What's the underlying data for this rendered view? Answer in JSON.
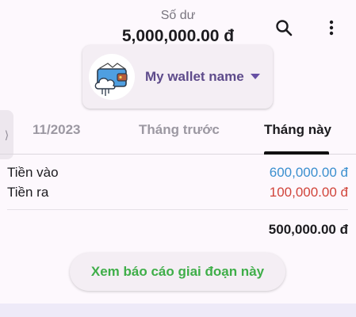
{
  "header": {
    "balance_label": "Số dư",
    "balance_value": "5,000,000.00 đ"
  },
  "icons": {
    "search": "search-icon",
    "more": "more-vert-icon",
    "wallet": "wallet-icon",
    "caret": "caret-down-icon",
    "side_handle": "chevron-right-icon"
  },
  "wallet": {
    "name": "My wallet name"
  },
  "side_handle": {
    "glyph": "⟩"
  },
  "tabs": [
    {
      "label": "11/2023",
      "active": false
    },
    {
      "label": "Tháng trước",
      "active": false
    },
    {
      "label": "Tháng này",
      "active": true
    }
  ],
  "summary": {
    "income_label": "Tiền vào",
    "income_value": "600,000.00 đ",
    "expense_label": "Tiền ra",
    "expense_value": "100,000.00 đ",
    "net_value": "500,000.00 đ"
  },
  "report_button": {
    "label": "Xem báo cáo giai đoạn này"
  },
  "colors": {
    "income": "#3a8fcf",
    "expense": "#d1443a",
    "report_text": "#3fae49",
    "accent": "#6750a4"
  }
}
